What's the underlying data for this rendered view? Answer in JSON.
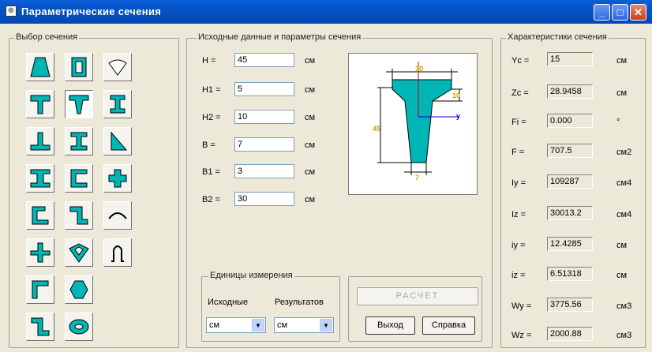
{
  "window": {
    "title": "Параметрические сечения"
  },
  "groups": {
    "selection": "Выбор сечения",
    "params": "Исходные данные и параметры сечения",
    "chars": "Характеристики сечения",
    "units": "Единицы измерения"
  },
  "params": [
    {
      "label": "H  =",
      "value": "45",
      "unit": "см"
    },
    {
      "label": "H1 =",
      "value": "5",
      "unit": "см"
    },
    {
      "label": "H2 =",
      "value": "10",
      "unit": "см"
    },
    {
      "label": "B  =",
      "value": "7",
      "unit": "см"
    },
    {
      "label": "B1 =",
      "value": "3",
      "unit": "см"
    },
    {
      "label": "B2 =",
      "value": "30",
      "unit": "см"
    }
  ],
  "chars": [
    {
      "label": "Yc =",
      "value": "15",
      "unit": "см"
    },
    {
      "label": "Zc =",
      "value": "28.9458",
      "unit": "см"
    },
    {
      "label": "Fi  =",
      "value": "0.000",
      "unit": "°"
    },
    {
      "label": "F  =",
      "value": "707.5",
      "unit": "см2"
    },
    {
      "label": "Iy  =",
      "value": "109287",
      "unit": "см4"
    },
    {
      "label": "Iz  =",
      "value": "30013.2",
      "unit": "см4"
    },
    {
      "label": "iy  =",
      "value": "12.4285",
      "unit": "см"
    },
    {
      "label": "iz  =",
      "value": "6.51318",
      "unit": "см"
    },
    {
      "label": "Wy =",
      "value": "3775.56",
      "unit": "см3"
    },
    {
      "label": "Wz =",
      "value": "2000.88",
      "unit": "см3"
    }
  ],
  "units": {
    "source_label": "Исходные",
    "result_label": "Результатов",
    "source_value": "см",
    "result_value": "см"
  },
  "buttons": {
    "calc": "РАСЧЕТ",
    "exit": "Выход",
    "help": "Справка"
  },
  "preview": {
    "dim_top": "30",
    "dim_h": "45",
    "dim_h2": "10",
    "dim_b": "7",
    "dim_y": "y"
  },
  "shapes": [
    "trapezoid-shape",
    "box-shape",
    "circle-segment-shape",
    "tee-shape",
    "tapered-tee-shape",
    "i-beam-shape",
    "inverted-tee-shape",
    "i-beam-wide-shape",
    "triangle-shape",
    "wide-flange-shape",
    "channel-shape",
    "cross-shape",
    "lipped-channel-shape",
    "zee-shape",
    "arc-shape",
    "plus-shape",
    "rhombus-shape",
    "omega-shape",
    "angle-shape",
    "hexagon-shape",
    "zee-lipped-shape",
    "ring-shape"
  ],
  "colors": {
    "fill": "#00b5b5",
    "titlebar": "#0553c7",
    "dim_red": "#cc0000",
    "dim_yellow": "#c8a000"
  }
}
